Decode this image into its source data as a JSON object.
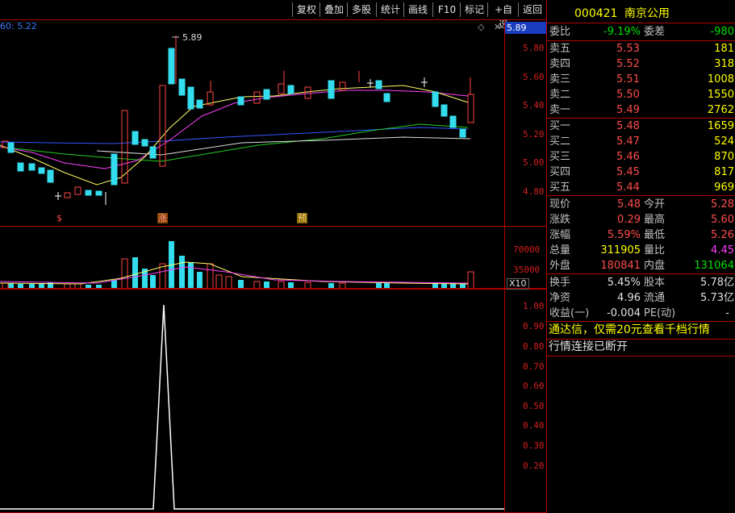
{
  "toolbar": {
    "buttons": [
      "复权",
      "叠加",
      "多股",
      "统计",
      "画线",
      "F10",
      "标记",
      "+自选",
      "返回"
    ]
  },
  "main_chart": {
    "ma_readout": "60: 5.22",
    "high_label": "5.89",
    "current_price_tag": "5.89",
    "y_ticks": [
      "5.80",
      "5.60",
      "5.40",
      "5.20",
      "5.00",
      "4.80"
    ],
    "markers": [
      "$",
      "涨",
      "预"
    ]
  },
  "volume_chart": {
    "y_ticks": [
      "70000",
      "35000"
    ],
    "unit_label": "X10"
  },
  "indicator_chart": {
    "y_ticks": [
      "1.00",
      "0.90",
      "0.80",
      "0.70",
      "0.60",
      "0.50",
      "0.40",
      "0.30",
      "0.20"
    ]
  },
  "quote": {
    "code": "000421",
    "name": "南京公用",
    "weibi_label": "委比",
    "weibi_value": "-9.19%",
    "weicha_label": "委差",
    "weicha_value": "-980",
    "sell": [
      {
        "label": "卖五",
        "price": "5.53",
        "vol": "181"
      },
      {
        "label": "卖四",
        "price": "5.52",
        "vol": "318"
      },
      {
        "label": "卖三",
        "price": "5.51",
        "vol": "1008"
      },
      {
        "label": "卖二",
        "price": "5.50",
        "vol": "1550"
      },
      {
        "label": "卖一",
        "price": "5.49",
        "vol": "2762"
      }
    ],
    "buy": [
      {
        "label": "买一",
        "price": "5.48",
        "vol": "1659"
      },
      {
        "label": "买二",
        "price": "5.47",
        "vol": "524"
      },
      {
        "label": "买三",
        "price": "5.46",
        "vol": "870"
      },
      {
        "label": "买四",
        "price": "5.45",
        "vol": "817"
      },
      {
        "label": "买五",
        "price": "5.44",
        "vol": "969"
      }
    ],
    "stats": [
      {
        "l1": "现价",
        "v1": "5.48",
        "l2": "今开",
        "v2": "5.28"
      },
      {
        "l1": "涨跌",
        "v1": "0.29",
        "l2": "最高",
        "v2": "5.60"
      },
      {
        "l1": "涨幅",
        "v1": "5.59%",
        "l2": "最低",
        "v2": "5.26"
      },
      {
        "l1": "总量",
        "v1": "311905",
        "l2": "量比",
        "v2": "4.45"
      },
      {
        "l1": "外盘",
        "v1": "180841",
        "l2": "内盘",
        "v2": "131064"
      }
    ],
    "fund": [
      {
        "l1": "换手",
        "v1": "5.45%",
        "l2": "股本",
        "v2": "5.78亿"
      },
      {
        "l1": "净资",
        "v1": "4.96",
        "l2": "流通",
        "v2": "5.73亿"
      },
      {
        "l1": "收益(一)",
        "v1": "-0.004",
        "l2": "PE(动)",
        "v2": "-"
      }
    ],
    "promo": "通达信，仅需20元查看千档行情",
    "status": "行情连接已断开"
  }
}
